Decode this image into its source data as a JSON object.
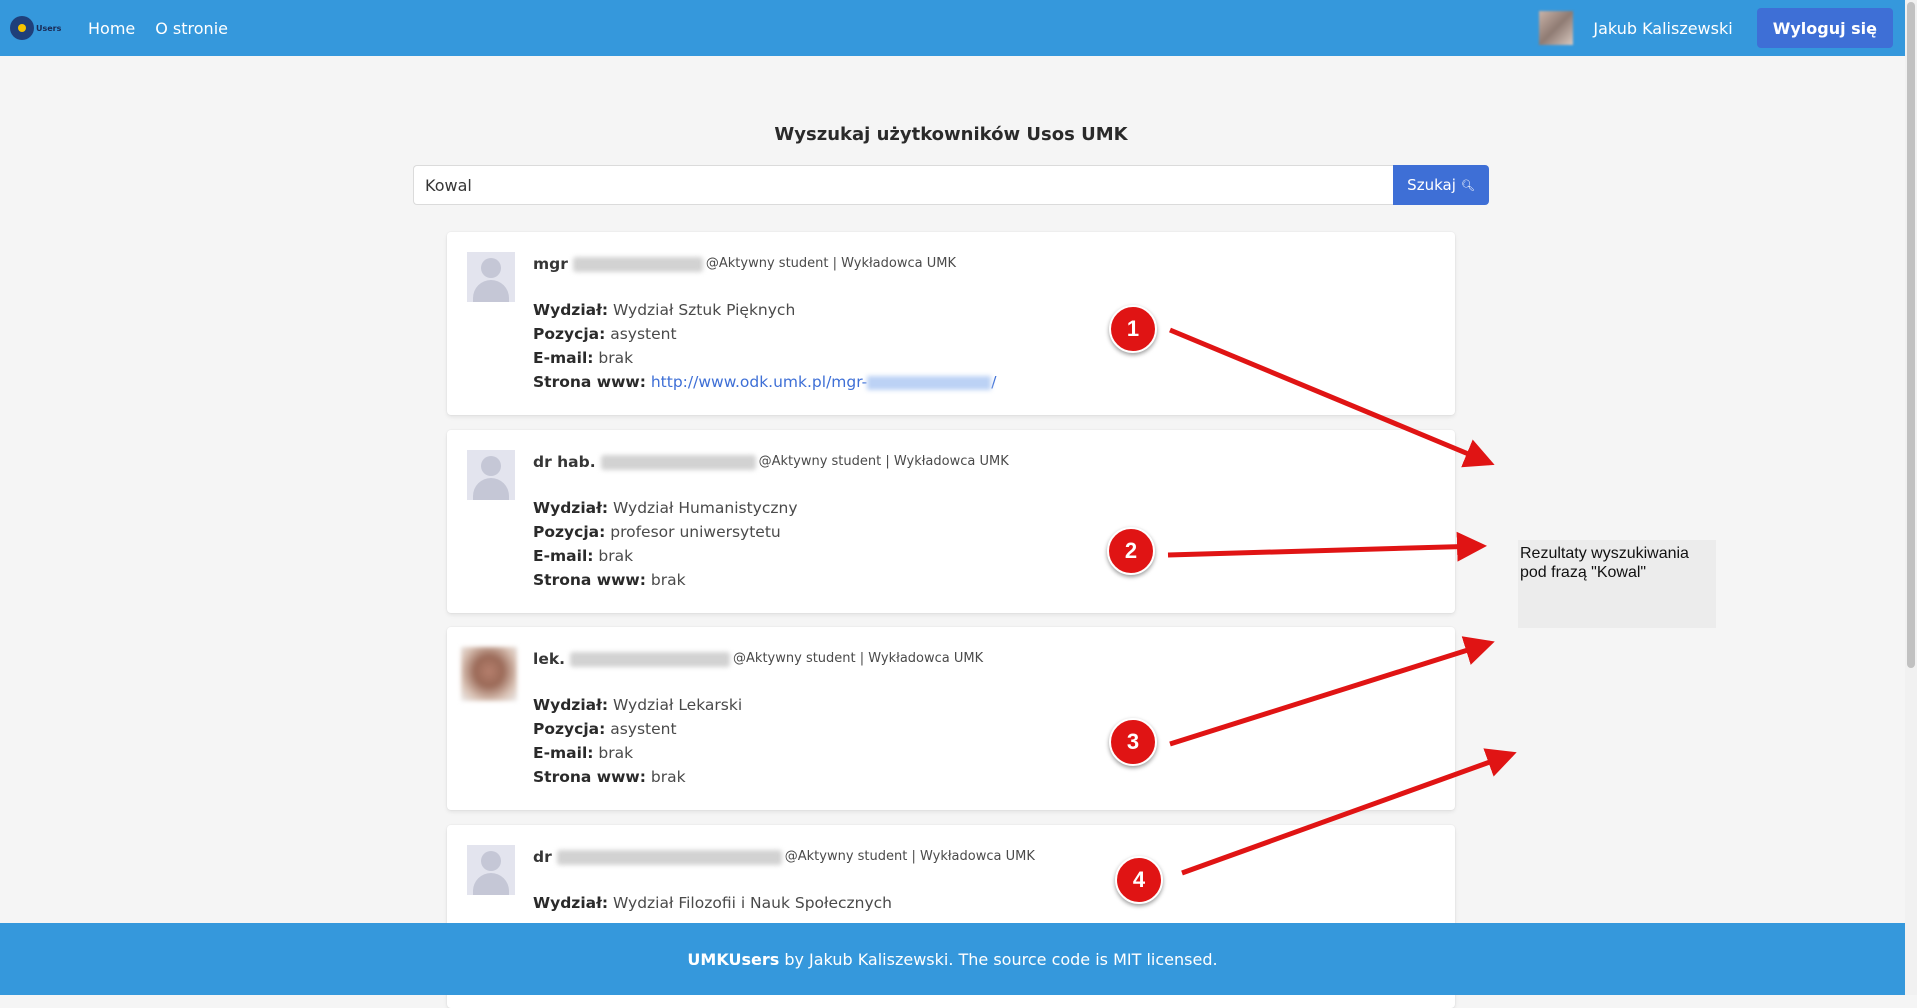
{
  "navbar": {
    "brand_text": "Users",
    "links": [
      {
        "label": "Home"
      },
      {
        "label": "O stronie"
      }
    ],
    "user_name": "Jakub Kaliszewski",
    "logout_label": "Wyloguj się"
  },
  "search": {
    "title": "Wyszukaj użytkowników Usos UMK",
    "value": "Kowal",
    "button_label": "Szukaj",
    "button_icon": "search-icon"
  },
  "labels": {
    "faculty": "Wydział:",
    "position": "Pozycja:",
    "email": "E-mail:",
    "website": "Strona www:"
  },
  "results": [
    {
      "title": "mgr",
      "tagline": "@Aktywny student | Wykładowca UMK",
      "faculty": "Wydział Sztuk Pięknych",
      "position": "asystent",
      "email": "brak",
      "website_prefix": "http://www.odk.umk.pl/mgr-",
      "website_suffix": "/"
    },
    {
      "title": "dr hab.",
      "tagline": "@Aktywny student | Wykładowca UMK",
      "faculty": "Wydział Humanistyczny",
      "position": "profesor uniwersytetu",
      "email": "brak",
      "website": "brak"
    },
    {
      "title": "lek.",
      "tagline": "@Aktywny student | Wykładowca UMK",
      "faculty": "Wydział Lekarski",
      "position": "asystent",
      "email": "brak",
      "website": "brak"
    },
    {
      "title": "dr",
      "tagline": "@Aktywny student | Wykładowca UMK",
      "faculty": "Wydział Filozofii i Nauk Społecznych"
    }
  ],
  "annotations": {
    "badges": [
      "1",
      "2",
      "3",
      "4"
    ],
    "note": "Rezultaty wyszukiwania pod frazą \"Kowal\"",
    "arrow_color": "#e01414"
  },
  "footer": {
    "brand": "UMKUsers",
    "text": " by Jakub Kaliszewski. The source code is MIT licensed."
  },
  "colors": {
    "navbar": "#3598dc",
    "primary_button": "#3e6fd6",
    "link": "#3e6fd6",
    "annotation_red": "#e01414"
  }
}
